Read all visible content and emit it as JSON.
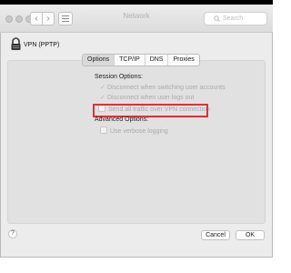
{
  "window": {
    "title": "Network"
  },
  "search": {
    "placeholder": "Search"
  },
  "header": {
    "service_name": "VPN (PPTP)"
  },
  "tabs": [
    {
      "label": "Options",
      "selected": true
    },
    {
      "label": "TCP/IP",
      "selected": false
    },
    {
      "label": "DNS",
      "selected": false
    },
    {
      "label": "Proxies",
      "selected": false
    }
  ],
  "session": {
    "heading": "Session Options:",
    "options": [
      {
        "label": "Disconnect when switching user accounts",
        "checked": true,
        "enabled": false
      },
      {
        "label": "Disconnect when user logs out",
        "checked": true,
        "enabled": false
      },
      {
        "label": "Send all traffic over VPN connection",
        "checked": false,
        "enabled": false
      }
    ]
  },
  "advanced": {
    "heading": "Advanced Options:",
    "options": [
      {
        "label": "Use verbose logging",
        "checked": false,
        "enabled": false
      }
    ]
  },
  "footer": {
    "help_label": "?",
    "cancel_label": "Cancel",
    "ok_label": "OK"
  },
  "colors": {
    "highlight_border": "#e0303a",
    "window_bg": "#ececec",
    "panel_bg": "#e1e1e1",
    "disabled_text": "#aaaaaa"
  }
}
